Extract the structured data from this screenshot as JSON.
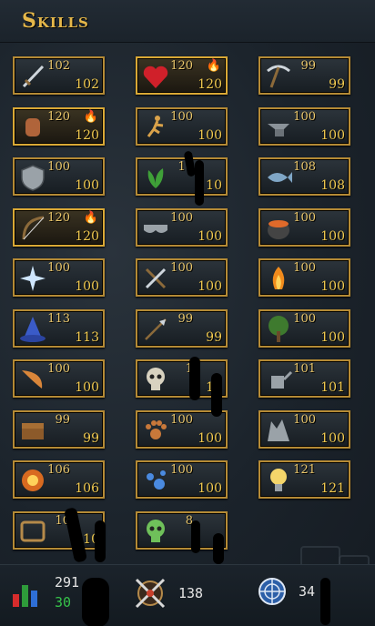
{
  "title": "Skills",
  "colors": {
    "border": "#b48a35",
    "text": "#f0c94f",
    "title": "#e6b84a"
  },
  "skills": [
    {
      "icon": "sword-icon",
      "current": "102",
      "base": "102",
      "flame": false
    },
    {
      "icon": "heart-icon",
      "current": "120",
      "base": "120",
      "flame": true
    },
    {
      "icon": "pickaxe-icon",
      "current": "99",
      "base": "99",
      "flame": false
    },
    {
      "icon": "fist-icon",
      "current": "120",
      "base": "120",
      "flame": true
    },
    {
      "icon": "running-man-icon",
      "current": "100",
      "base": "100",
      "flame": false
    },
    {
      "icon": "anvil-icon",
      "current": "100",
      "base": "100",
      "flame": false
    },
    {
      "icon": "shield-icon",
      "current": "100",
      "base": "100",
      "flame": false
    },
    {
      "icon": "herb-icon",
      "current": "10",
      "base": "10",
      "flame": false
    },
    {
      "icon": "fish-icon",
      "current": "108",
      "base": "108",
      "flame": false
    },
    {
      "icon": "bow-icon",
      "current": "120",
      "base": "120",
      "flame": true
    },
    {
      "icon": "mask-icon",
      "current": "100",
      "base": "100",
      "flame": false
    },
    {
      "icon": "cauldron-icon",
      "current": "100",
      "base": "100",
      "flame": false
    },
    {
      "icon": "star-icon",
      "current": "100",
      "base": "100",
      "flame": false
    },
    {
      "icon": "hammer-chisel-icon",
      "current": "100",
      "base": "100",
      "flame": false
    },
    {
      "icon": "fire-icon",
      "current": "100",
      "base": "100",
      "flame": false
    },
    {
      "icon": "wizard-hat-icon",
      "current": "113",
      "base": "113",
      "flame": false
    },
    {
      "icon": "arrow-icon",
      "current": "99",
      "base": "99",
      "flame": false
    },
    {
      "icon": "tree-icon",
      "current": "100",
      "base": "100",
      "flame": false
    },
    {
      "icon": "horn-icon",
      "current": "100",
      "base": "100",
      "flame": false
    },
    {
      "icon": "skull-icon",
      "current": "1",
      "base": "11",
      "flame": false
    },
    {
      "icon": "watering-can-icon",
      "current": "101",
      "base": "101",
      "flame": false
    },
    {
      "icon": "chest-icon",
      "current": "99",
      "base": "99",
      "flame": false
    },
    {
      "icon": "paw-icon",
      "current": "100",
      "base": "100",
      "flame": false
    },
    {
      "icon": "wolf-icon",
      "current": "100",
      "base": "100",
      "flame": false
    },
    {
      "icon": "hand-orb-icon",
      "current": "106",
      "base": "106",
      "flame": false
    },
    {
      "icon": "orbs-icon",
      "current": "100",
      "base": "100",
      "flame": false
    },
    {
      "icon": "lightbulb-icon",
      "current": "121",
      "base": "121",
      "flame": false
    },
    {
      "icon": "trap-icon",
      "current": "10",
      "base": "10",
      "flame": false
    },
    {
      "icon": "green-skull-icon",
      "current": "8",
      "base": "8",
      "flame": false
    }
  ],
  "footer": {
    "total_level": "291",
    "total_level_sub": "30",
    "combat_level": "138",
    "quest_points": "34"
  }
}
